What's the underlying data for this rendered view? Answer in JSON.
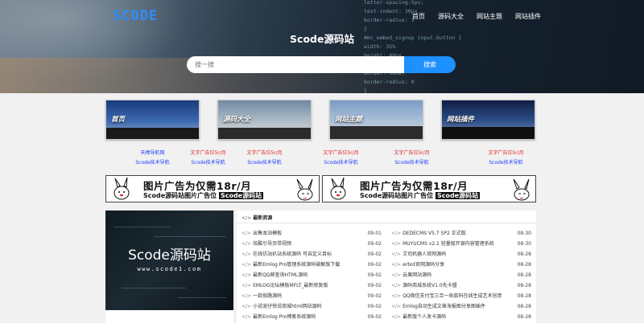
{
  "header": {
    "logo": "SCODE",
    "nav": [
      "首页",
      "源码大全",
      "网站主题",
      "网站插件"
    ],
    "site_title": "Scode源码站",
    "search": {
      "placeholder": "搜一搜",
      "button": "搜索"
    },
    "code_lines": [
      "letter-spacing:5px;",
      "text-indent: 30px",
      "border-radius: 1",
      "}",
      "#mc_embed_signup input.button {",
      "width: 35%",
      "height: 40px",
      "background: #",
      "border: none;",
      "border-radius: 0",
      "}",
      "margin: 0 auto",
      "letter-spacing:",
      "border-radius:"
    ]
  },
  "cards": [
    {
      "label": "首页",
      "links": [
        "天棒导航网",
        "Scode技术导航"
      ],
      "link_colors": [
        "#1e3cff",
        "#1e3cff"
      ]
    },
    {
      "label": "源码大全",
      "links": [
        "文字广告位5r/月",
        "Scode技术导航"
      ],
      "link_colors": [
        "#e02020",
        "#1e3cff"
      ]
    },
    {
      "label": "网站主题",
      "links": [
        "文字广告位5r/月",
        "Scode技术导航"
      ],
      "link_colors": [
        "#e02020",
        "#1e3cff"
      ]
    },
    {
      "label": "网站插件",
      "links": [
        "文字广告位5r/月",
        "Scode技术导航"
      ],
      "link_colors": [
        "#e02020",
        "#1e3cff"
      ]
    }
  ],
  "middle_links": [
    {
      "links": [
        "文字广告位5r/月",
        "Scode技术导航"
      ]
    },
    {
      "links": [
        "文字广告位5r/月",
        "Scode技术导航"
      ]
    }
  ],
  "ads": [
    {
      "line1": "图片广告为仅需18r/月",
      "line2_prefix": "Scode源码站图片广告位",
      "line2_name": "Scode源码站"
    },
    {
      "line1": "图片广告为仅需18r/月",
      "line2_prefix": "Scode源码站图片广告位",
      "line2_name": "Scode源码站"
    }
  ],
  "banner": {
    "title": "Scode源码站",
    "url": "www.scode1.com"
  },
  "news": {
    "heading": "最新资源",
    "left": [
      {
        "title": "出售本站模板",
        "date": "09-01"
      },
      {
        "title": "炫酷引导页带视频",
        "date": "09-02"
      },
      {
        "title": "在线仿站扒站系统源码 可自定义目标",
        "date": "09-02"
      },
      {
        "title": "最新Emlog Pro管理系统源码破解版下载",
        "date": "09-02"
      },
      {
        "title": "最新QQ邮查询HTML源码",
        "date": "09-02"
      },
      {
        "title": "EMLOG论坛模板MFLT_最新修复版",
        "date": "09-02"
      },
      {
        "title": "一款抛路源码",
        "date": "09-02"
      },
      {
        "title": "小说宠仔快说商城html网站源码",
        "date": "09-02"
      },
      {
        "title": "最新Emlog Pro博客系统源码",
        "date": "09-02"
      }
    ],
    "right": [
      {
        "title": "DEDECMS V5.7 SP2 正式版",
        "date": "08-30"
      },
      {
        "title": "MUYUCMS v2.1 轻量级开源内容管理系统",
        "date": "08-30"
      },
      {
        "title": "艾司机器人官网源码",
        "date": "08-28"
      },
      {
        "title": "erbot官网源码分享",
        "date": "08-28"
      },
      {
        "title": "云果网站源码",
        "date": "08-28"
      },
      {
        "title": "源码商城系统V1.0先卡盟",
        "date": "08-28"
      },
      {
        "title": "QQ微信支付宝三合一收款码在线生成艺术创意",
        "date": "08-28"
      },
      {
        "title": "Emlog自动生成文章海报图分享图插件",
        "date": "08-28"
      },
      {
        "title": "最新版个人发卡源码",
        "date": "08-28"
      }
    ]
  }
}
